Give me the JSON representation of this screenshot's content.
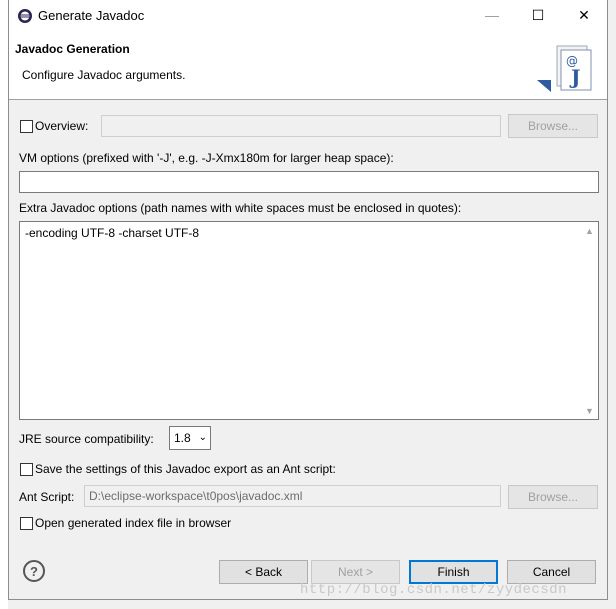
{
  "window": {
    "title": "Generate Javadoc",
    "minimize_glyph": "—",
    "maximize_glyph": "☐",
    "close_glyph": "✕"
  },
  "header": {
    "title": "Javadoc Generation",
    "description": "Configure Javadoc arguments.",
    "icon": "javadoc-wizard-icon"
  },
  "overview": {
    "label": "Overview:",
    "checked": false,
    "value": "",
    "browse_label": "Browse..."
  },
  "vm_options": {
    "label": "VM options (prefixed with '-J', e.g. -J-Xmx180m for larger heap space):",
    "value": ""
  },
  "extra_options": {
    "label": "Extra Javadoc options (path names with white spaces must be enclosed in quotes):",
    "value": "-encoding UTF-8 -charset UTF-8"
  },
  "jre": {
    "label": "JRE source compatibility:",
    "selected": "1.8"
  },
  "ant": {
    "save_label": "Save the settings of this Javadoc export as an Ant script:",
    "save_checked": false,
    "script_label": "Ant Script:",
    "script_value": "D:\\eclipse-workspace\\t0pos\\javadoc.xml",
    "browse_label": "Browse..."
  },
  "open_index": {
    "label": "Open generated index file in browser",
    "checked": false
  },
  "footer": {
    "help_glyph": "?",
    "back_label": "< Back",
    "next_label": "Next >",
    "finish_label": "Finish",
    "cancel_label": "Cancel"
  },
  "watermark": "http://blog.csdn.net/zyydecsdn",
  "colors": {
    "accent": "#0078d7",
    "dialog_bg": "#f0f0f0",
    "header_bg": "#ffffff"
  }
}
